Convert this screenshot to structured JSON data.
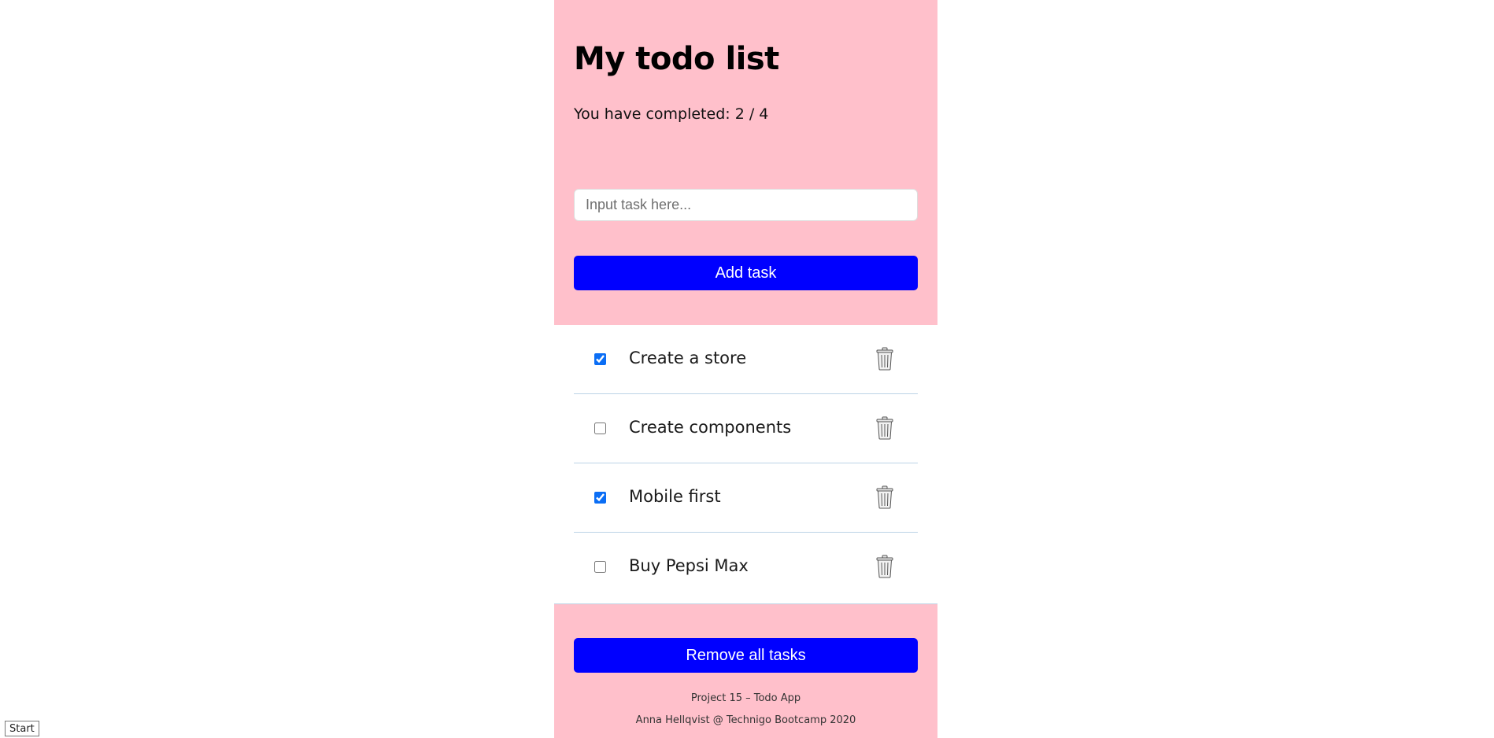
{
  "header": {
    "title": "My todo list",
    "completed_text": "You have completed: 2 / 4"
  },
  "input": {
    "placeholder": "Input task here...",
    "value": ""
  },
  "add_button": {
    "label": "Add task"
  },
  "tasks": [
    {
      "label": "Create a store",
      "checked": true
    },
    {
      "label": "Create components",
      "checked": false
    },
    {
      "label": "Mobile first",
      "checked": true
    },
    {
      "label": "Buy Pepsi Max",
      "checked": false
    }
  ],
  "remove_button": {
    "label": "Remove all tasks"
  },
  "footer": {
    "line1": "Project 15 – Todo App",
    "line2": "Anna Hellqvist @ Technigo Bootcamp 2020"
  },
  "start_button": {
    "label": "Start"
  },
  "colors": {
    "header_bg": "#ffc0cb",
    "button_bg": "#0000ff",
    "checkbox_accent": "#0b6ef5",
    "divider": "#bcd4e6"
  },
  "icons": {
    "delete": "trash-icon"
  }
}
